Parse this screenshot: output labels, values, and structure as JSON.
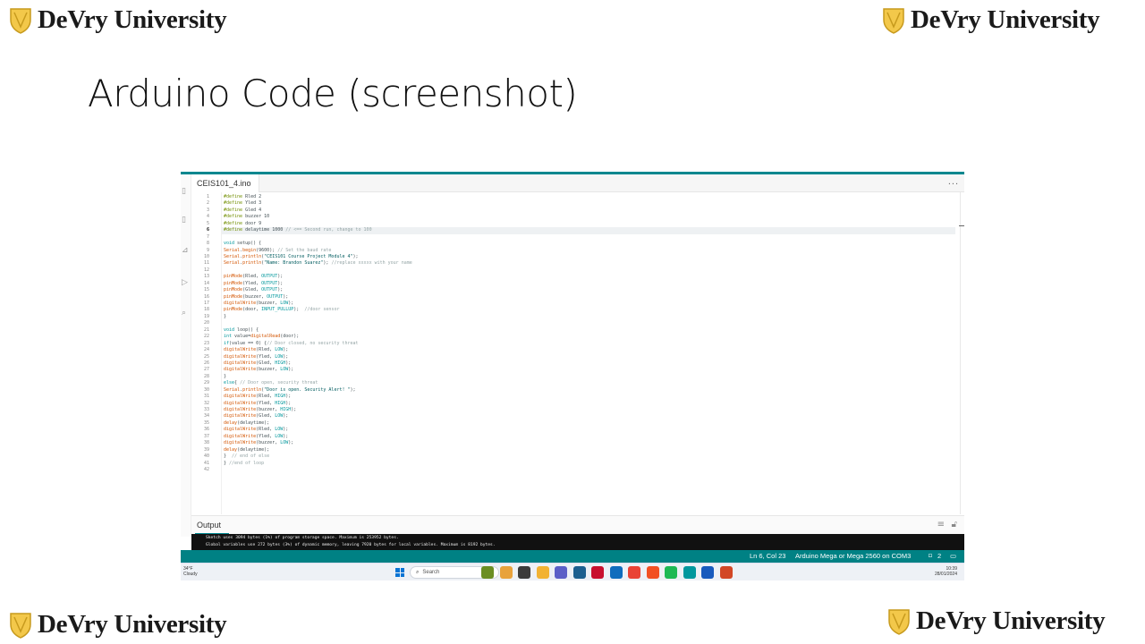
{
  "branding": {
    "logo_text": "DeVry University"
  },
  "slide": {
    "title": "Arduino Code (screenshot)"
  },
  "ide": {
    "file_tab": "CEIS101_4.ino",
    "more_menu": "...",
    "code_lines": [
      "#define Rled 2",
      "#define Yled 3",
      "#define Gled 4",
      "#define buzzer 10",
      "#define door 9",
      "#define delaytime 1000 // <== Second run, change to 100",
      "",
      "void setup() {",
      "Serial.begin(9600); // Set the baud rate",
      "Serial.println(\"CEIS101 Course Project Module 4\");",
      "Serial.println(\"Name: Brandon Suarez\"); //replace xxxxx with your name",
      "",
      "pinMode(Rled, OUTPUT);",
      "pinMode(Yled, OUTPUT);",
      "pinMode(Gled, OUTPUT);",
      "pinMode(buzzer, OUTPUT);",
      "digitalWrite(buzzer, LOW);",
      "pinMode(door, INPUT_PULLUP);  //door sensor",
      "}",
      "",
      "void loop() {",
      "int value=digitalRead(door);",
      "if(value == 0) {// Door closed, no security threat",
      "digitalWrite(Rled, LOW);",
      "digitalWrite(Yled, LOW);",
      "digitalWrite(Gled, HIGH);",
      "digitalWrite(buzzer, LOW);",
      "}",
      "else{ // Door open, security threat",
      "Serial.println(\"Door is open. Security Alert! \");",
      "digitalWrite(Rled, HIGH);",
      "digitalWrite(Yled, HIGH);",
      "digitalWrite(buzzer, HIGH);",
      "digitalWrite(Gled, LOW);",
      "delay(delaytime);",
      "digitalWrite(Rled, LOW);",
      "digitalWrite(Yled, LOW);",
      "digitalWrite(buzzer, LOW);",
      "delay(delaytime);",
      "}  // end of else",
      "} //end of loop",
      ""
    ],
    "highlighted_line": 6,
    "output_label": "Output",
    "console_lines": [
      "Sketch uses 3094 bytes (1%) of program storage space. Maximum is 253952 bytes.",
      "Global variables use 272 bytes (3%) of dynamic memory, leaving 7920 bytes for local variables. Maximum is 8192 bytes."
    ],
    "status": {
      "cursor": "Ln 6, Col 23",
      "board": "Arduino Mega or Mega 2560 on COM3",
      "notifications": "2"
    }
  },
  "taskbar": {
    "temperature": "34°F",
    "weather": "Cloudy",
    "search_placeholder": "Search",
    "time": "10:39",
    "date": "28/01/2024"
  }
}
